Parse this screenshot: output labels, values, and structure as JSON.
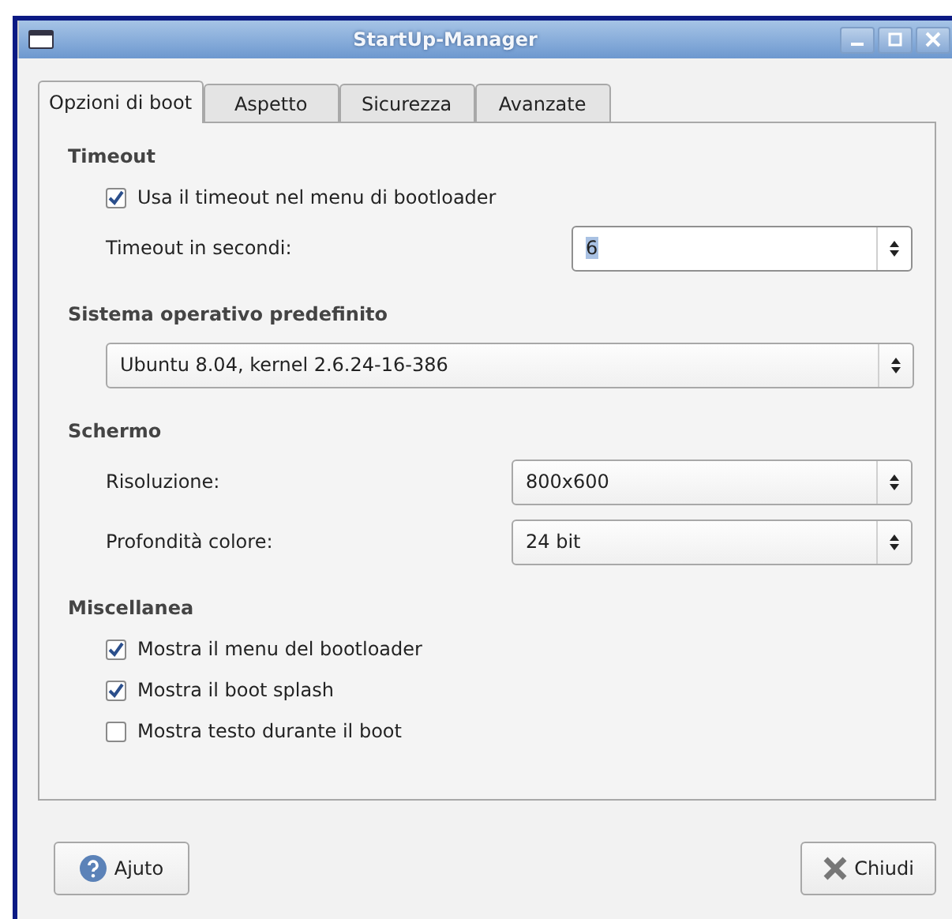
{
  "window": {
    "title": "StartUp-Manager"
  },
  "tabs": [
    {
      "label": "Opzioni di boot",
      "selected": true
    },
    {
      "label": "Aspetto",
      "selected": false
    },
    {
      "label": "Sicurezza",
      "selected": false
    },
    {
      "label": "Avanzate",
      "selected": false
    }
  ],
  "sections": [
    {
      "heading": "Timeout",
      "rows": [
        {
          "kind": "checkbox",
          "label": "Usa il timeout nel menu di bootloader",
          "checked": true
        },
        {
          "kind": "spin",
          "label": "Timeout in secondi:",
          "value": "6"
        }
      ]
    },
    {
      "heading": "Sistema operativo predefinito",
      "rows": [
        {
          "kind": "combo",
          "value": "Ubuntu 8.04, kernel 2.6.24-16-386"
        }
      ]
    },
    {
      "heading": "Schermo",
      "rows": [
        {
          "kind": "combo",
          "label": "Risoluzione:",
          "value": "800x600"
        },
        {
          "kind": "combo",
          "label": "Profondità colore:",
          "value": "24 bit"
        }
      ]
    },
    {
      "heading": "Miscellanea",
      "rows": [
        {
          "kind": "checkbox",
          "label": "Mostra il menu del bootloader",
          "checked": true
        },
        {
          "kind": "checkbox",
          "label": "Mostra il boot splash",
          "checked": true
        },
        {
          "kind": "checkbox",
          "label": "Mostra testo durante il boot",
          "checked": false
        }
      ]
    }
  ],
  "buttons": [
    {
      "label": "Ajuto",
      "kind": "help"
    },
    {
      "label": "Chiudi",
      "kind": "close"
    }
  ]
}
